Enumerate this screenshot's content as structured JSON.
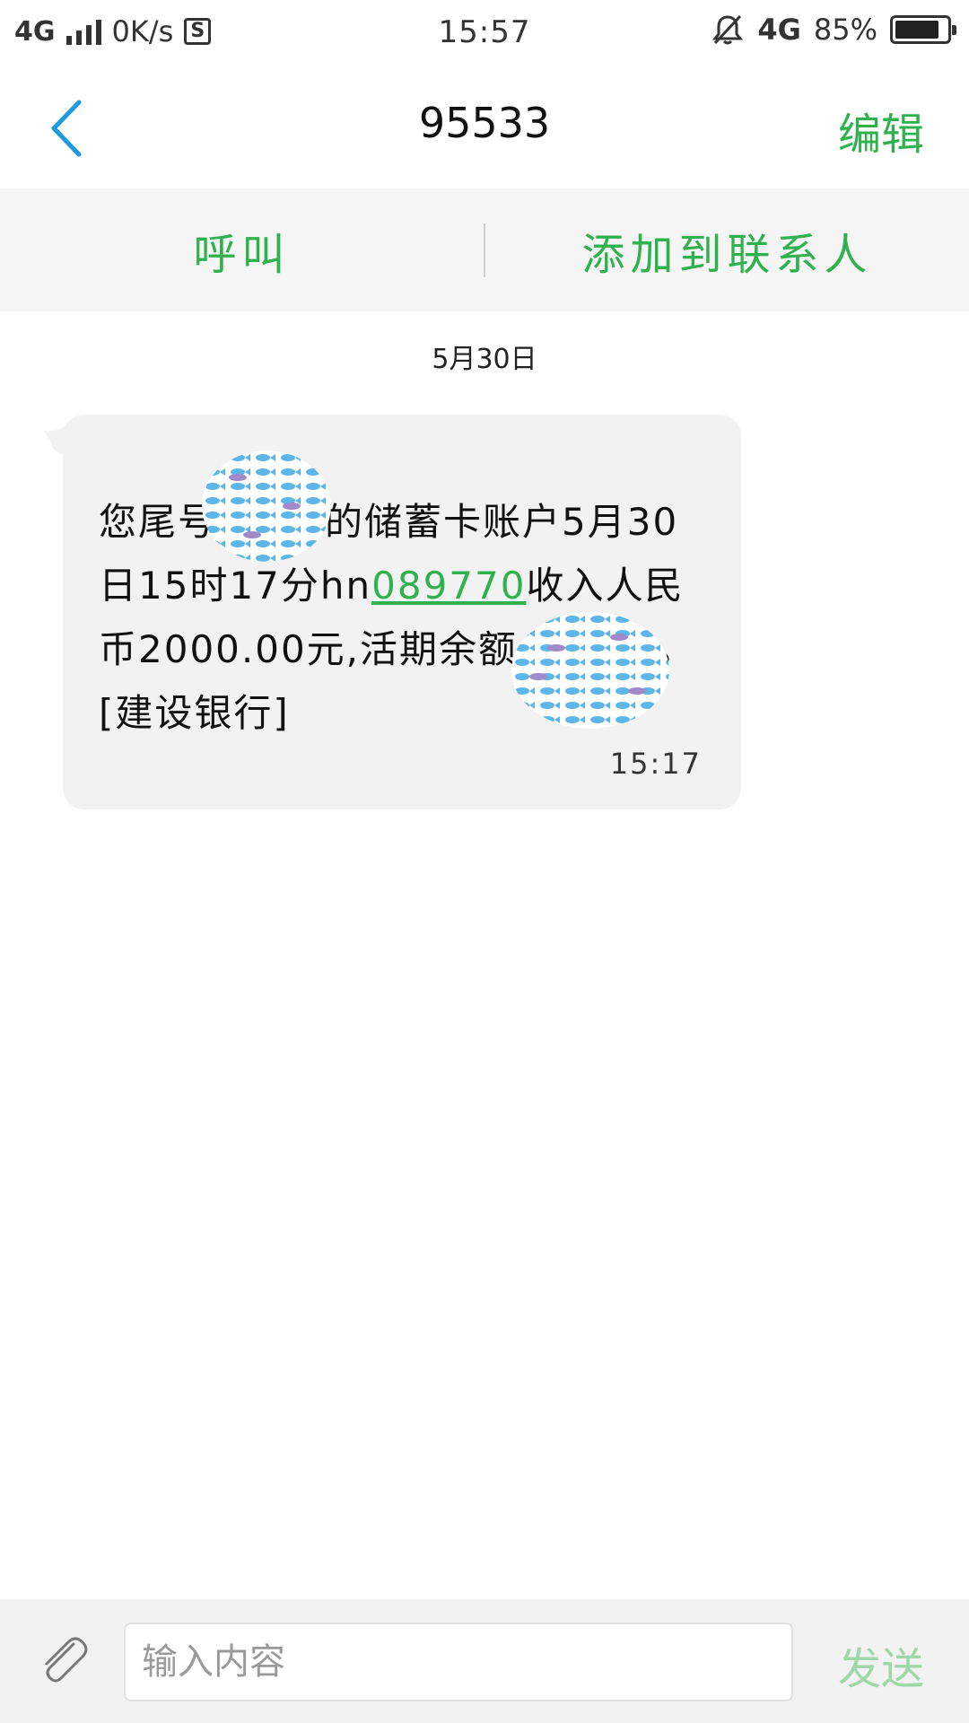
{
  "status_bar": {
    "network": "4G",
    "speed": "0K/s",
    "app_icon": "S",
    "time": "15:57",
    "network_right": "4G",
    "battery": "85%",
    "battery_level": 0.85
  },
  "header": {
    "title": "95533",
    "edit_label": "编辑"
  },
  "actions": {
    "call_label": "呼叫",
    "add_contact_label": "添加到联系人"
  },
  "conversation": {
    "date": "5月30日",
    "message": {
      "part1": "您尾号",
      "part2": "的储蓄卡账户5月30日15时17分hn",
      "link": "089770",
      "part3": "收入人民币2000.00元,活期余额",
      "part4": "元。[建设银行]",
      "time": "15:17"
    }
  },
  "composer": {
    "placeholder": "输入内容",
    "send_label": "发送"
  },
  "colors": {
    "accent_green": "#2fb24e",
    "back_blue": "#1a9be0"
  }
}
